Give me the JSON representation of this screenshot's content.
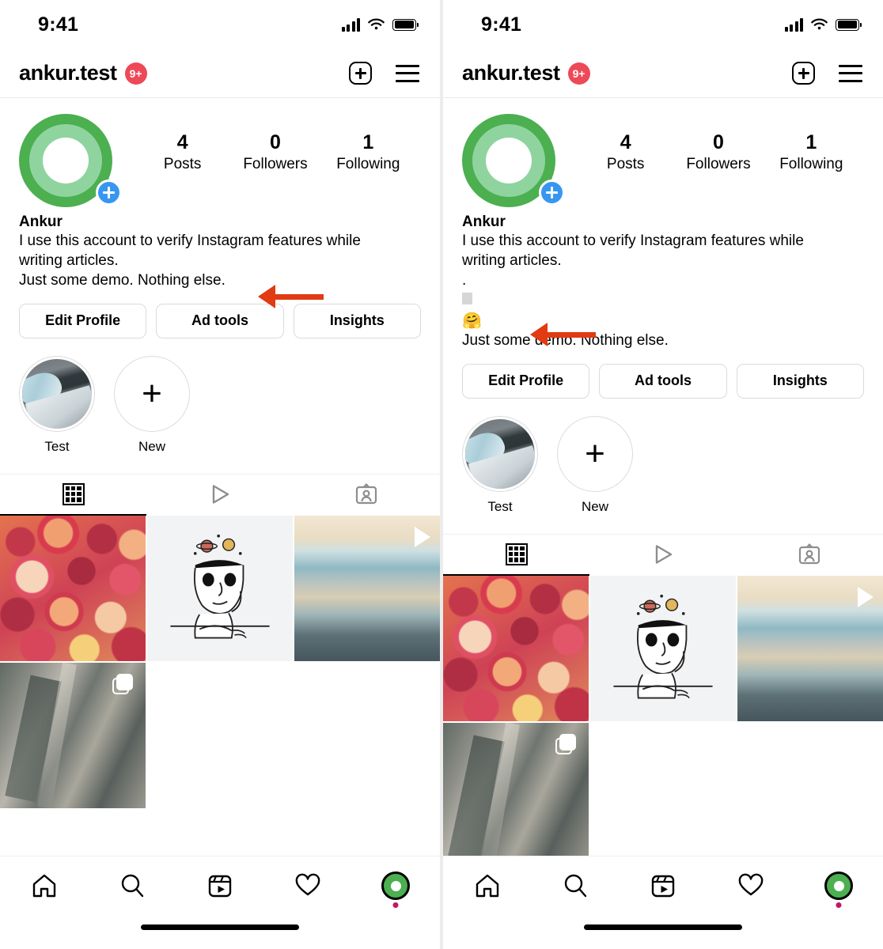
{
  "status_bar": {
    "time": "9:41",
    "icons": [
      "signal-bars-icon",
      "wifi-icon",
      "battery-icon"
    ]
  },
  "header": {
    "username": "ankur.test",
    "notification_badge": "9+",
    "badge_color": "#ED4956",
    "create_icon": "plus-square-icon",
    "menu_icon": "hamburger-menu-icon"
  },
  "profile": {
    "avatar": {
      "ring_color_outer": "#4CAF50",
      "ring_color_inner": "#8FD49F",
      "add_badge_color": "#3797F0",
      "add_badge_icon": "plus-icon"
    },
    "stats": [
      {
        "value": "4",
        "label": "Posts"
      },
      {
        "value": "0",
        "label": "Followers"
      },
      {
        "value": "1",
        "label": "Following"
      }
    ],
    "display_name": "Ankur",
    "bio_left": [
      "I use this account to verify Instagram features while",
      "writing articles.",
      "Just some demo. Nothing else."
    ],
    "bio_right": [
      "I use this account to verify Instagram features while",
      "writing articles.",
      ".",
      "□",
      "🤗",
      "Just some demo. Nothing else."
    ],
    "actions": [
      {
        "label": "Edit Profile"
      },
      {
        "label": "Ad tools"
      },
      {
        "label": "Insights"
      }
    ]
  },
  "highlights": [
    {
      "label": "Test",
      "type": "photo"
    },
    {
      "label": "New",
      "type": "add"
    }
  ],
  "tabs": [
    {
      "name": "grid-tab",
      "icon": "grid-icon",
      "active": true
    },
    {
      "name": "reels-tab",
      "icon": "play-icon",
      "active": false
    },
    {
      "name": "tagged-tab",
      "icon": "tagged-person-icon",
      "active": false
    }
  ],
  "posts": [
    {
      "name": "post-pomegranates",
      "type": "photo",
      "overlay": "none"
    },
    {
      "name": "post-illustration",
      "type": "photo",
      "overlay": "none"
    },
    {
      "name": "post-video",
      "type": "video",
      "overlay": "play-icon"
    },
    {
      "name": "post-cityscape",
      "type": "carousel",
      "overlay": "carousel-icon"
    }
  ],
  "bottom_nav": [
    {
      "name": "nav-home",
      "icon": "home-icon"
    },
    {
      "name": "nav-search",
      "icon": "search-icon"
    },
    {
      "name": "nav-reels",
      "icon": "reels-icon"
    },
    {
      "name": "nav-activity",
      "icon": "heart-icon"
    },
    {
      "name": "nav-profile",
      "icon": "profile-avatar-icon",
      "has_dot": true
    }
  ],
  "annotations": {
    "arrow_color": "#E03B12",
    "left_arrow_target": "bio-third-line",
    "right_arrow_target": "bio-empty-lines"
  }
}
